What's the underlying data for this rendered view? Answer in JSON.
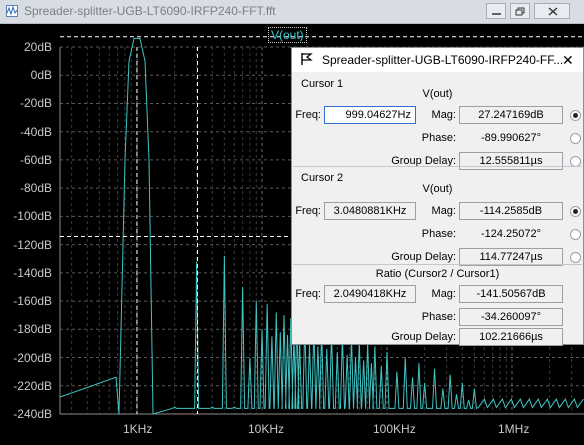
{
  "window": {
    "title": "Spreader-splitter-UGB-LT6090-IRFP240-FFT.fft"
  },
  "plot": {
    "trace_label": "V(out)",
    "y_ticks": [
      "20dB",
      "0dB",
      "-20dB",
      "-40dB",
      "-60dB",
      "-80dB",
      "-100dB",
      "-120dB",
      "-140dB",
      "-160dB",
      "-180dB",
      "-200dB",
      "-220dB",
      "-240dB"
    ],
    "x_ticks": [
      "1KHz",
      "10KHz",
      "100KHz",
      "1MHz"
    ],
    "trace_color": "#3fc4c4",
    "cursor_color": "#ffffff"
  },
  "dialog": {
    "title": "Spreader-splitter-UGB-LT6090-IRFP240-FF...",
    "close_glyph": "✕",
    "cursor1": {
      "label": "Cursor 1",
      "trace": "V(out)",
      "freq_label": "Freq:",
      "freq": "999.04627Hz",
      "mag_label": "Mag:",
      "mag": "27.247169dB",
      "phase_label": "Phase:",
      "phase": "-89.990627°",
      "gd_label": "Group Delay:",
      "gd": "12.555811µs"
    },
    "cursor2": {
      "label": "Cursor 2",
      "trace": "V(out)",
      "freq_label": "Freq:",
      "freq": "3.0480881KHz",
      "mag_label": "Mag:",
      "mag": "-114.2585dB",
      "phase_label": "Phase:",
      "phase": "-124.25072°",
      "gd_label": "Group Delay:",
      "gd": "114.77247µs"
    },
    "ratio": {
      "label": "Ratio (Cursor2 / Cursor1)",
      "freq_label": "Freq:",
      "freq": "2.0490418KHz",
      "mag_label": "Mag:",
      "mag": "-141.50567dB",
      "phase_label": "Phase:",
      "phase": "-34.260097°",
      "gd_label": "Group Delay:",
      "gd": "102.21666µs"
    }
  }
}
